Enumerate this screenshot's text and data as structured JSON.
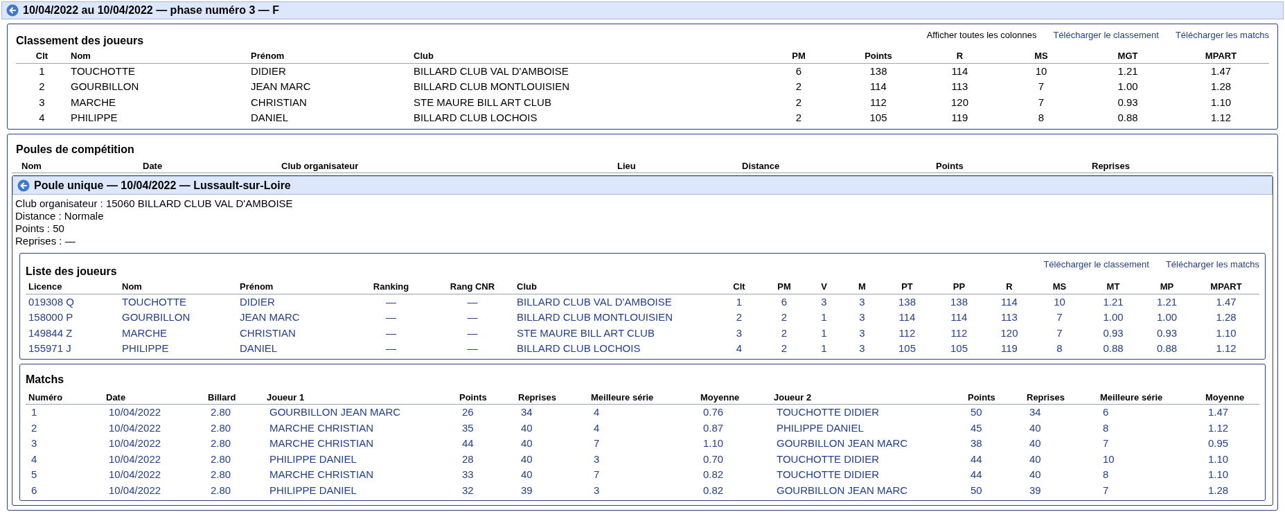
{
  "header": {
    "title": "10/04/2022 au 10/04/2022 — phase numéro 3 — F"
  },
  "ranking": {
    "title": "Classement des joueurs",
    "show_all": "Afficher toutes les colonnes",
    "links": [
      "Télécharger le classement",
      "Télécharger les matchs"
    ],
    "columns": [
      "Clt",
      "Nom",
      "Prénom",
      "Club",
      "PM",
      "Points",
      "R",
      "MS",
      "MGT",
      "MPART"
    ],
    "rows": [
      [
        "1",
        "TOUCHOTTE",
        "DIDIER",
        "BILLARD CLUB VAL D'AMBOISE",
        "6",
        "138",
        "114",
        "10",
        "1.21",
        "1.47"
      ],
      [
        "2",
        "GOURBILLON",
        "JEAN MARC",
        "BILLARD CLUB MONTLOUISIEN",
        "2",
        "114",
        "113",
        "7",
        "1.00",
        "1.28"
      ],
      [
        "3",
        "MARCHE",
        "CHRISTIAN",
        "STE MAURE BILL ART CLUB",
        "2",
        "112",
        "120",
        "7",
        "0.93",
        "1.10"
      ],
      [
        "4",
        "PHILIPPE",
        "DANIEL",
        "BILLARD CLUB LOCHOIS",
        "2",
        "105",
        "119",
        "8",
        "0.88",
        "1.12"
      ]
    ]
  },
  "pools": {
    "title": "Poules de compétition",
    "columns": [
      "Nom",
      "Date",
      "Club organisateur",
      "Lieu",
      "Distance",
      "Points",
      "Reprises"
    ],
    "pool": {
      "title": "Poule unique — 10/04/2022 — Lussault-sur-Loire",
      "info": [
        "Club organisateur : 15060 BILLARD CLUB VAL D'AMBOISE",
        "Distance : Normale",
        "Points : 50",
        "Reprises : —"
      ],
      "players": {
        "title": "Liste des joueurs",
        "links": [
          "Télécharger le classement",
          "Télécharger les matchs"
        ],
        "columns": [
          "Licence",
          "Nom",
          "Prénom",
          "Ranking",
          "Rang CNR",
          "Club",
          "Clt",
          "PM",
          "V",
          "M",
          "PT",
          "PP",
          "R",
          "MS",
          "MT",
          "MP",
          "MPART"
        ],
        "rows": [
          [
            "019308 Q",
            "TOUCHOTTE",
            "DIDIER",
            "—",
            "—",
            "BILLARD CLUB VAL D'AMBOISE",
            "1",
            "6",
            "3",
            "3",
            "138",
            "138",
            "114",
            "10",
            "1.21",
            "1.21",
            "1.47"
          ],
          [
            "158000 P",
            "GOURBILLON",
            "JEAN MARC",
            "—",
            "—",
            "BILLARD CLUB MONTLOUISIEN",
            "2",
            "2",
            "1",
            "3",
            "114",
            "114",
            "113",
            "7",
            "1.00",
            "1.00",
            "1.28"
          ],
          [
            "149844 Z",
            "MARCHE",
            "CHRISTIAN",
            "—",
            "—",
            "STE MAURE BILL ART CLUB",
            "3",
            "2",
            "1",
            "3",
            "112",
            "112",
            "120",
            "7",
            "0.93",
            "0.93",
            "1.10"
          ],
          [
            "155971 J",
            "PHILIPPE",
            "DANIEL",
            "—",
            "—",
            "BILLARD CLUB LOCHOIS",
            "4",
            "2",
            "1",
            "3",
            "105",
            "105",
            "119",
            "8",
            "0.88",
            "0.88",
            "1.12"
          ]
        ]
      },
      "matches": {
        "title": "Matchs",
        "columns": [
          "Numéro",
          "Date",
          "Billard",
          "Joueur 1",
          "Points",
          "Reprises",
          "Meilleure série",
          "Moyenne",
          "Joueur 2",
          "Points",
          "Reprises",
          "Meilleure série",
          "Moyenne"
        ],
        "rows": [
          [
            "1",
            "10/04/2022",
            "2.80",
            "GOURBILLON JEAN MARC",
            "26",
            "34",
            "4",
            "0.76",
            "TOUCHOTTE DIDIER",
            "50",
            "34",
            "6",
            "1.47"
          ],
          [
            "2",
            "10/04/2022",
            "2.80",
            "MARCHE CHRISTIAN",
            "35",
            "40",
            "4",
            "0.87",
            "PHILIPPE DANIEL",
            "45",
            "40",
            "8",
            "1.12"
          ],
          [
            "3",
            "10/04/2022",
            "2.80",
            "MARCHE CHRISTIAN",
            "44",
            "40",
            "7",
            "1.10",
            "GOURBILLON JEAN MARC",
            "38",
            "40",
            "7",
            "0.95"
          ],
          [
            "4",
            "10/04/2022",
            "2.80",
            "PHILIPPE DANIEL",
            "28",
            "40",
            "3",
            "0.70",
            "TOUCHOTTE DIDIER",
            "44",
            "40",
            "10",
            "1.10"
          ],
          [
            "5",
            "10/04/2022",
            "2.80",
            "MARCHE CHRISTIAN",
            "33",
            "40",
            "7",
            "0.82",
            "TOUCHOTTE DIDIER",
            "44",
            "40",
            "8",
            "1.10"
          ],
          [
            "6",
            "10/04/2022",
            "2.80",
            "PHILIPPE DANIEL",
            "32",
            "39",
            "3",
            "0.82",
            "GOURBILLON JEAN MARC",
            "50",
            "39",
            "7",
            "1.28"
          ]
        ]
      }
    }
  }
}
